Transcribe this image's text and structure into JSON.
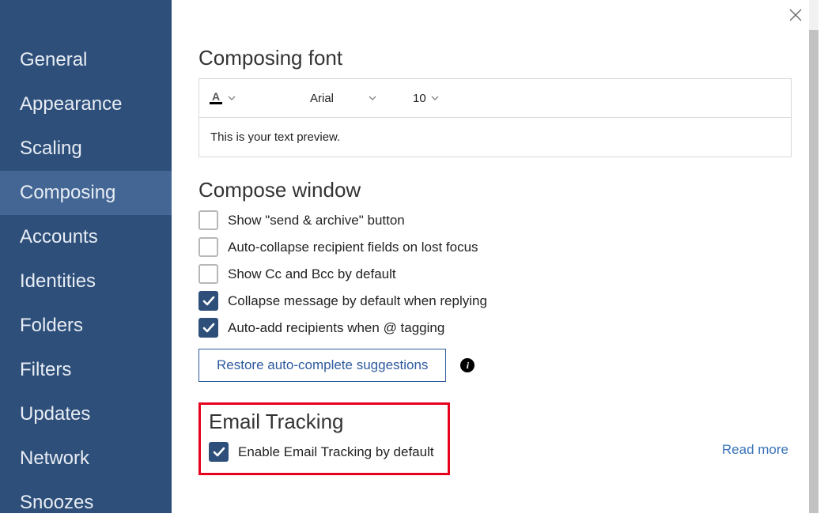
{
  "sidebar": {
    "items": [
      {
        "label": "General"
      },
      {
        "label": "Appearance"
      },
      {
        "label": "Scaling"
      },
      {
        "label": "Composing"
      },
      {
        "label": "Accounts"
      },
      {
        "label": "Identities"
      },
      {
        "label": "Folders"
      },
      {
        "label": "Filters"
      },
      {
        "label": "Updates"
      },
      {
        "label": "Network"
      },
      {
        "label": "Snoozes"
      }
    ],
    "active_index": 3
  },
  "sections": {
    "composing_font": {
      "title": "Composing font",
      "font_family": "Arial",
      "font_size": "10",
      "preview_text": "This is your text preview."
    },
    "compose_window": {
      "title": "Compose window",
      "options": [
        {
          "label": "Show \"send & archive\" button",
          "checked": false
        },
        {
          "label": "Auto-collapse recipient fields on lost focus",
          "checked": false
        },
        {
          "label": "Show Cc and Bcc by default",
          "checked": false
        },
        {
          "label": "Collapse message by default when replying",
          "checked": true
        },
        {
          "label": "Auto-add recipients when @ tagging",
          "checked": true
        }
      ],
      "restore_button": "Restore auto-complete suggestions"
    },
    "email_tracking": {
      "title": "Email Tracking",
      "option": {
        "label": "Enable Email Tracking by default",
        "checked": true
      },
      "read_more": "Read more"
    }
  }
}
